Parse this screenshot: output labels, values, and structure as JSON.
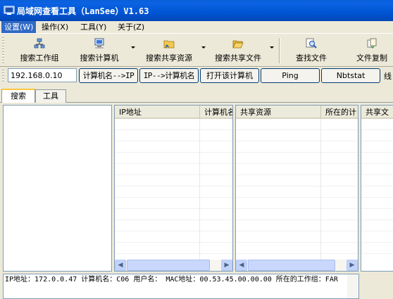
{
  "window": {
    "title": "局域网查看工具（LanSee）V1.63"
  },
  "menu": [
    {
      "label": "设置(W)"
    },
    {
      "label": "操作(X)"
    },
    {
      "label": "工具(Y)"
    },
    {
      "label": "关于(Z)"
    }
  ],
  "toolbar": {
    "buttons": [
      {
        "label": "搜索工作组",
        "icon": "network-icon"
      },
      {
        "label": "搜索计算机",
        "icon": "computer-icon"
      },
      {
        "label": "搜索共享资源",
        "icon": "shared-folder-icon"
      },
      {
        "label": "搜索共享文件",
        "icon": "open-folder-icon"
      },
      {
        "label": "查找文件",
        "icon": "magnifier-icon"
      },
      {
        "label": "文件复制",
        "icon": "copy-file-icon"
      }
    ]
  },
  "actionbar": {
    "ip_value": "192.168.0.10",
    "buttons": [
      {
        "label": "计算机名-->IP"
      },
      {
        "label": "IP-->计算机名"
      },
      {
        "label": "打开该计算机"
      },
      {
        "label": "Ping"
      },
      {
        "label": "Nbtstat"
      }
    ],
    "tail_label": "线"
  },
  "tabs": [
    {
      "label": "搜索",
      "active": true
    },
    {
      "label": "工具",
      "active": false
    }
  ],
  "panels": {
    "computers": {
      "columns": [
        "IP地址",
        "计算机名"
      ]
    },
    "shares": {
      "columns": [
        "共享资源",
        "所在的计"
      ]
    },
    "files": {
      "columns": [
        "共享文"
      ]
    }
  },
  "status": {
    "text": "IP地址：172.0.0.47 计算机名：C06 用户名： MAC地址：00.53.45.00.00.00 所在的工作组：FAR"
  },
  "colors": {
    "titlebar": "#0055d4",
    "active_menu": "#316ac5",
    "chrome": "#ece9d8"
  }
}
